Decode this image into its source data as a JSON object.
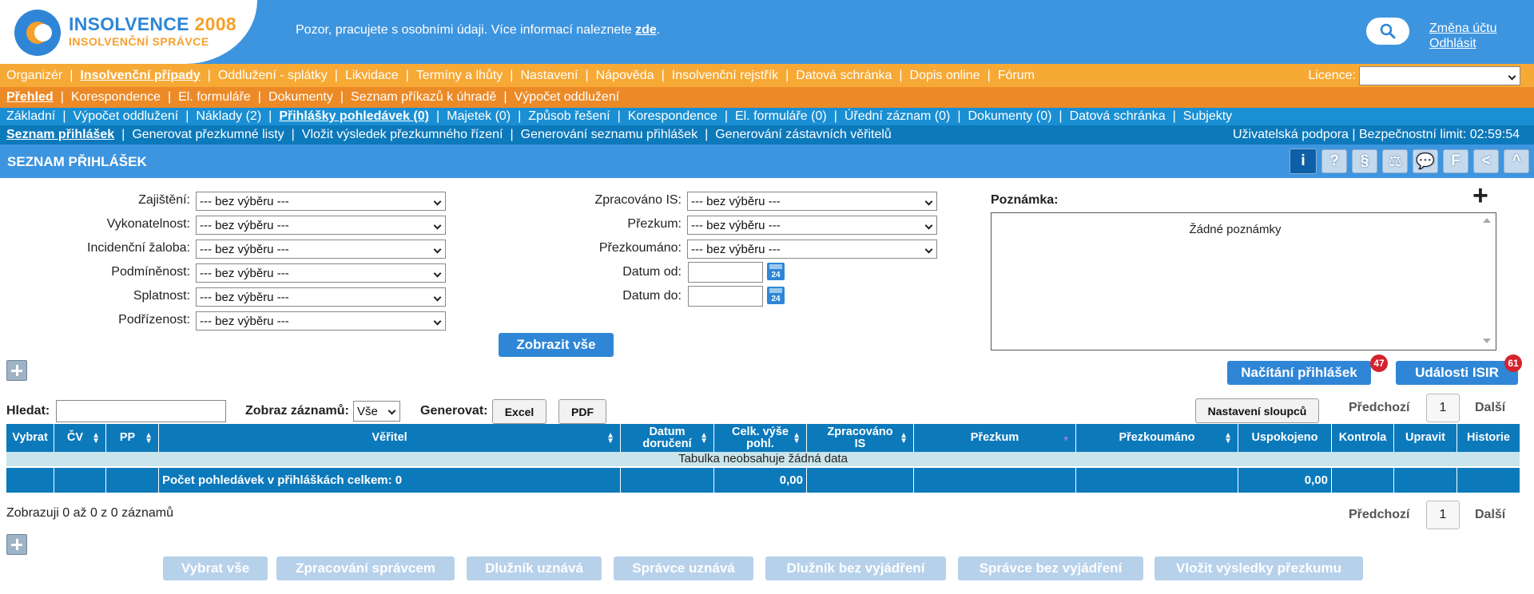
{
  "header": {
    "brand_main": "INSOLVENCE",
    "brand_year": "2008",
    "brand_sub": "INSOLVENČNÍ SPRÁVCE",
    "notice": "Pozor, pracujete s osobními údaji. Více informací naleznete",
    "notice_link": "zde",
    "notice_end": ".",
    "account_link": "Změna účtu",
    "logout_link": "Odhlásit"
  },
  "menu_main": [
    "Organizér",
    "Insolvenční případy",
    "Oddlužení - splátky",
    "Likvidace",
    "Termíny a lhůty",
    "Nastavení",
    "Nápověda",
    "Insolvenční rejstřík",
    "Datová schránka",
    "Dopis online",
    "Fórum"
  ],
  "licence_label": "Licence:",
  "licence_value": "",
  "menu_case": [
    "Přehled",
    "Korespondence",
    "El. formuláře",
    "Dokumenty",
    "Seznam příkazů k úhradě",
    "Výpočet oddlužení"
  ],
  "menu_sub": [
    "Základní",
    "Výpočet oddlužení",
    "Náklady (2)",
    "Přihlášky pohledávek (0)",
    "Majetek (0)",
    "Způsob řešení",
    "Korespondence",
    "El. formuláře (0)",
    "Úřední záznam (0)",
    "Dokumenty (0)",
    "Datová schránka",
    "Subjekty"
  ],
  "menu_claims": [
    "Seznam přihlášek",
    "Generovat přezkumné listy",
    "Vložit výsledek přezkumného řízení",
    "Generování seznamu přihlášek",
    "Generování zástavních věřitelů"
  ],
  "support_text": "Uživatelská podpora | Bezpečnostní limit: 02:59:54",
  "page_title": "SEZNAM PŘIHLÁŠEK",
  "toolbar_icons": [
    "i",
    "?",
    "§",
    "⚖",
    "💬",
    "F",
    "<",
    "^"
  ],
  "filters_left": [
    {
      "label": "Zajištění:",
      "value": "--- bez výběru ---"
    },
    {
      "label": "Vykonatelnost:",
      "value": "--- bez výběru ---"
    },
    {
      "label": "Incidenční žaloba:",
      "value": "--- bez výběru ---"
    },
    {
      "label": "Podmíněnost:",
      "value": "--- bez výběru ---"
    },
    {
      "label": "Splatnost:",
      "value": "--- bez výběru ---"
    },
    {
      "label": "Podřízenost:",
      "value": "--- bez výběru ---"
    }
  ],
  "filters_right": [
    {
      "label": "Zpracováno IS:",
      "value": "--- bez výběru ---"
    },
    {
      "label": "Přezkum:",
      "value": "--- bez výběru ---"
    },
    {
      "label": "Přezkoumáno:",
      "value": "--- bez výběru ---"
    }
  ],
  "date_from_label": "Datum od:",
  "date_to_label": "Datum do:",
  "calendar_day": "24",
  "show_all_button": "Zobrazit vše",
  "note": {
    "label": "Poznámka:",
    "empty_text": "Žádné poznámky",
    "add": "+"
  },
  "load_claims_button": "Načítání přihlášek",
  "load_claims_badge": "47",
  "isir_events_button": "Události ISIR",
  "isir_events_badge": "61",
  "search": {
    "label": "Hledat:",
    "value": ""
  },
  "show_records_label": "Zobraz záznamů:",
  "show_records_value": "Vše",
  "generate_label": "Generovat:",
  "excel_button": "Excel",
  "pdf_button": "PDF",
  "columns_settings_button": "Nastavení sloupců",
  "pager": {
    "prev": "Předchozí",
    "page": "1",
    "next": "Další"
  },
  "table": {
    "columns": [
      "Vybrat",
      "ČV",
      "PP",
      "Věřitel",
      "Datum doručení",
      "Celk. výše pohl.",
      "Zpracováno IS",
      "Přezkum",
      "Přezkoumáno",
      "Uspokojeno",
      "Kontrola",
      "Upravit",
      "Historie"
    ],
    "empty_text": "Tabulka neobsahuje žádná data",
    "summary_label": "Počet pohledávek v přihláškách celkem: 0",
    "summary_total": "0,00",
    "summary_satisfied": "0,00"
  },
  "status_text": "Zobrazuji 0 až 0 z 0 záznamů",
  "bottom_buttons": [
    "Vybrat vše",
    "Zpracování správcem",
    "Dlužník uznává",
    "Správce uznává",
    "Dlužník bez vyjádření",
    "Správce bez vyjádření",
    "Vložit výsledky přezkumu"
  ]
}
